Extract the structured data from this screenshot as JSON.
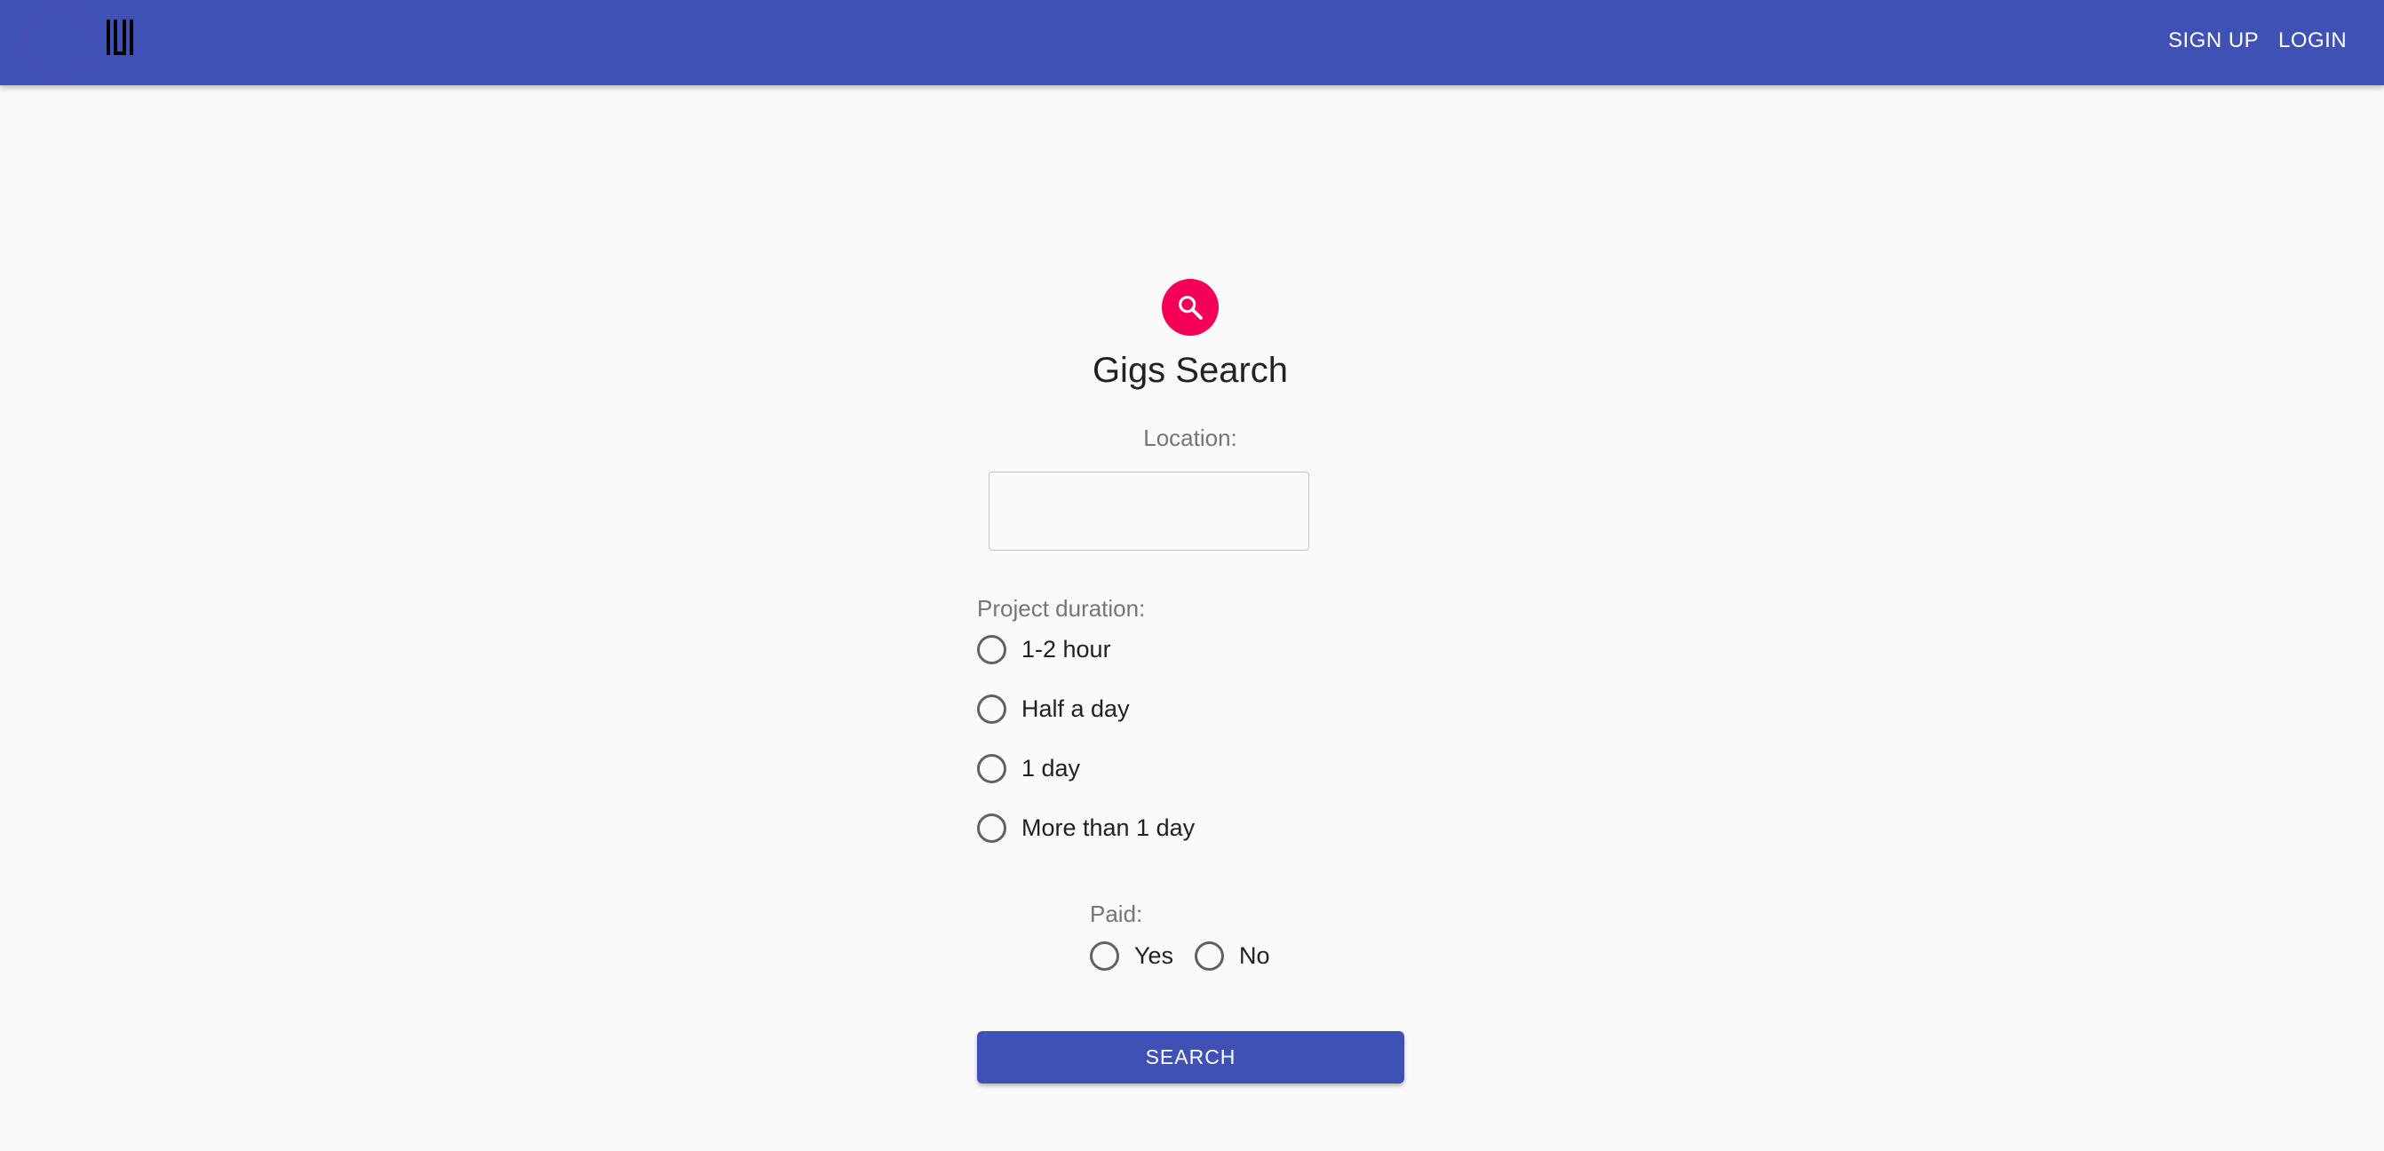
{
  "header": {
    "bg_color": "#3f51b5",
    "logo_icon": "logo-icon",
    "nav": {
      "signup_label": "SIGN UP",
      "login_label": "LOGIN"
    }
  },
  "main": {
    "avatar_icon": "search-icon",
    "avatar_color": "#f50057",
    "title": "Gigs Search",
    "location": {
      "label": "Location:",
      "value": "",
      "placeholder": ""
    },
    "duration": {
      "label": "Project duration:",
      "options": [
        "1-2 hour",
        "Half a day",
        "1 day",
        "More than 1 day"
      ],
      "selected": null
    },
    "paid": {
      "label": "Paid:",
      "options": [
        "Yes",
        "No"
      ],
      "selected": null
    },
    "search_button": {
      "label": "SEARCH",
      "color": "#3f51b5"
    }
  }
}
